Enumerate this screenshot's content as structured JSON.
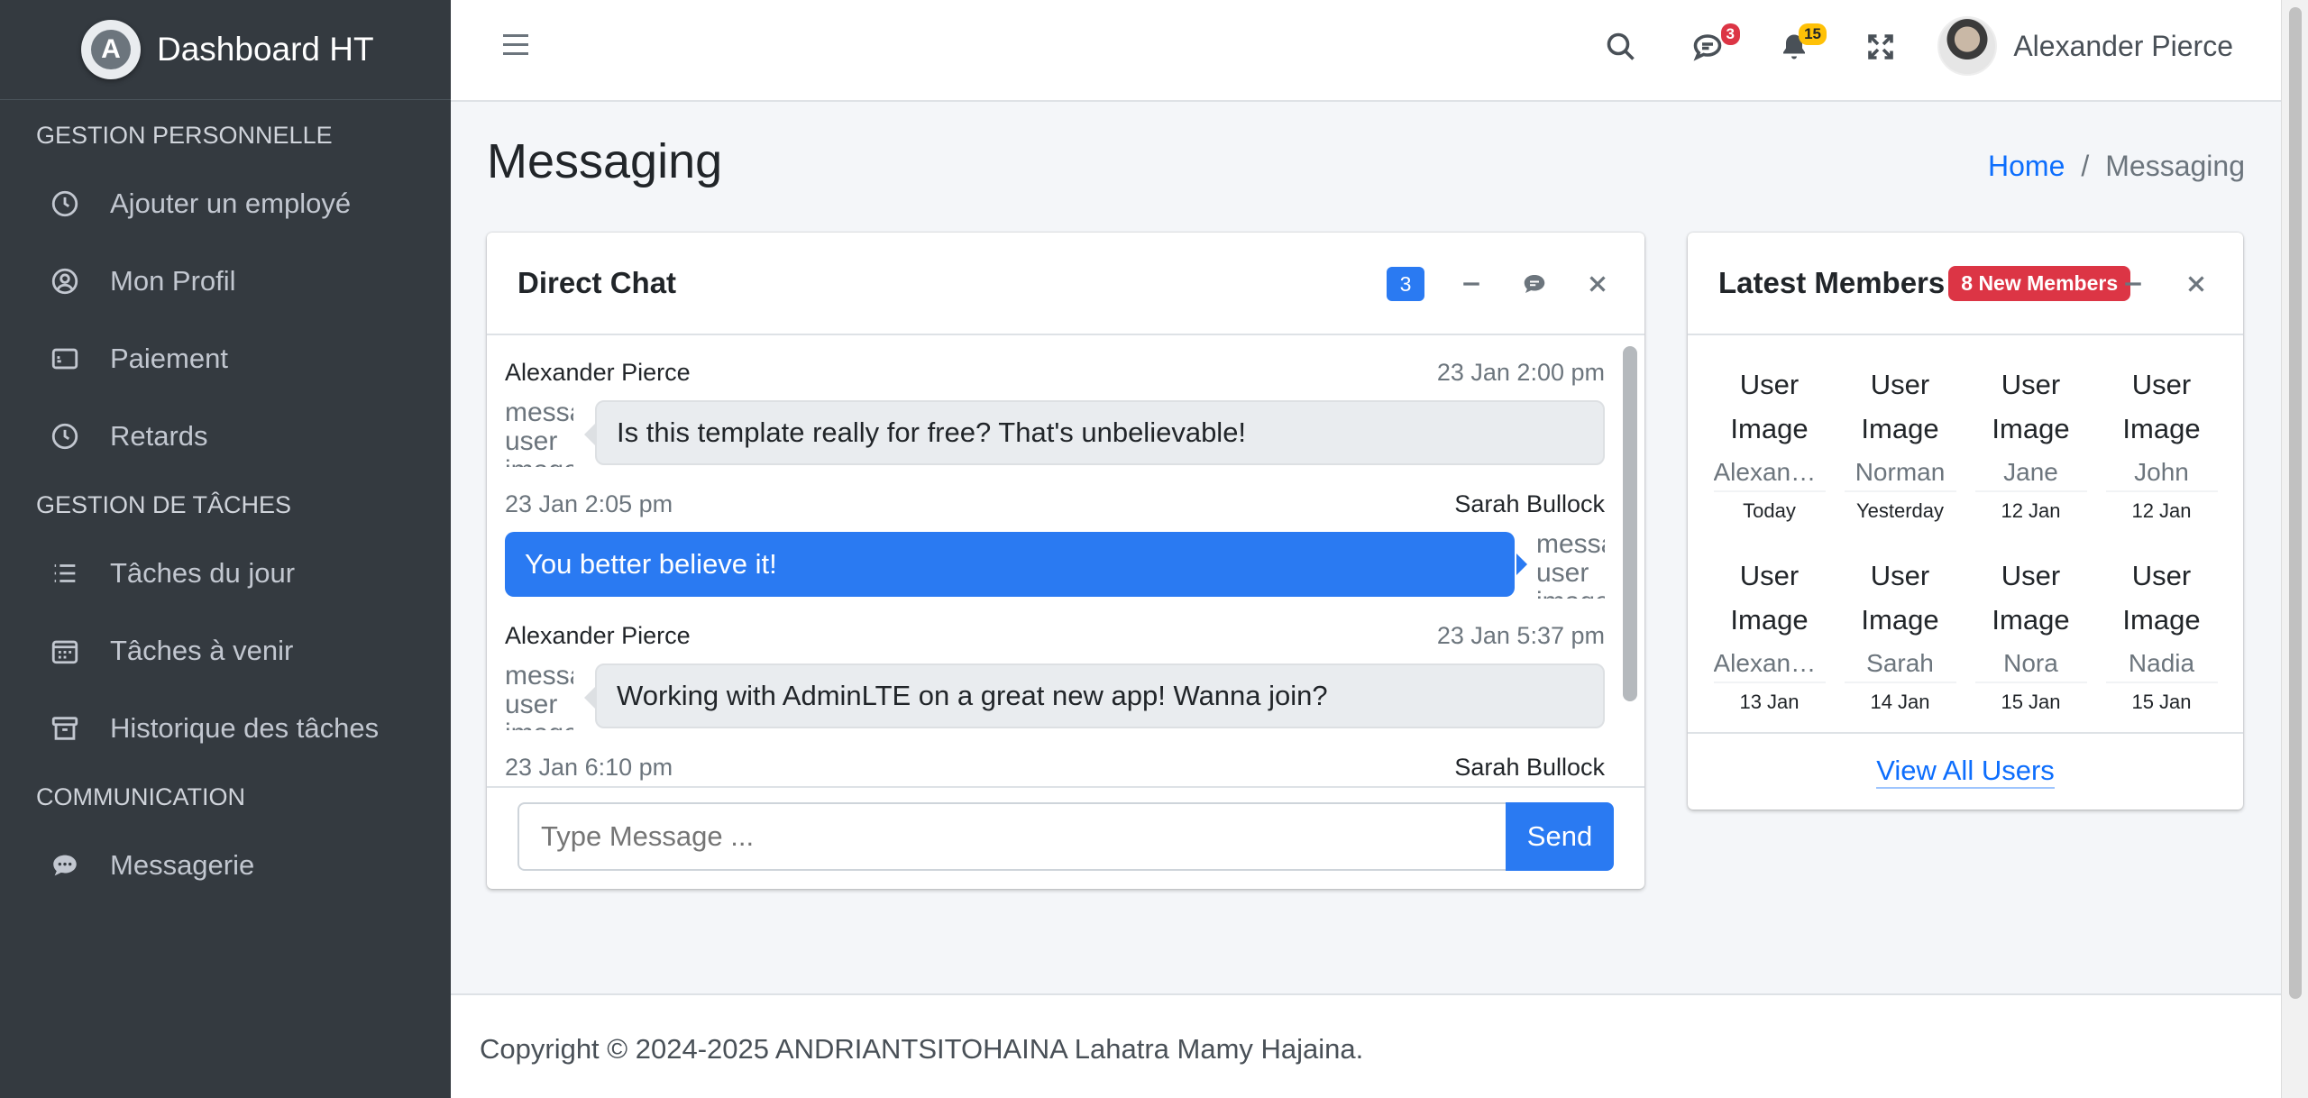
{
  "brand": {
    "name": "Dashboard HT",
    "logo_letter": "A"
  },
  "sidebar": {
    "sections": [
      {
        "header": "GESTION PERSONNELLE",
        "items": [
          {
            "label": "Ajouter un employé",
            "icon": "clock-icon"
          },
          {
            "label": "Mon Profil",
            "icon": "user-circle-icon"
          },
          {
            "label": "Paiement",
            "icon": "card-icon"
          },
          {
            "label": "Retards",
            "icon": "clock-icon"
          }
        ]
      },
      {
        "header": "GESTION DE TÂCHES",
        "items": [
          {
            "label": "Tâches du jour",
            "icon": "list-icon"
          },
          {
            "label": "Tâches à venir",
            "icon": "calendar-icon"
          },
          {
            "label": "Historique des tâches",
            "icon": "archive-icon"
          }
        ]
      },
      {
        "header": "COMMUNICATION",
        "items": [
          {
            "label": "Messagerie",
            "icon": "chat-icon"
          }
        ]
      }
    ]
  },
  "topbar": {
    "messages_count": "3",
    "notifications_count": "15",
    "user_name": "Alexander Pierce"
  },
  "page": {
    "title": "Messaging",
    "breadcrumb": {
      "home": "Home",
      "separator": "/",
      "current": "Messaging"
    }
  },
  "chat": {
    "title": "Direct Chat",
    "badge": "3",
    "messages": [
      {
        "name": "Alexander Pierce",
        "time": "23 Jan 2:00 pm",
        "text": "Is this template really for free? That's unbelievable!",
        "side": "left",
        "img_alt": "message user image"
      },
      {
        "name": "Sarah Bullock",
        "time": "23 Jan 2:05 pm",
        "text": "You better believe it!",
        "side": "right",
        "img_alt": "message user image"
      },
      {
        "name": "Alexander Pierce",
        "time": "23 Jan 5:37 pm",
        "text": "Working with AdminLTE on a great new app! Wanna join?",
        "side": "left",
        "img_alt": "message user image"
      },
      {
        "name": "Sarah Bullock",
        "time": "23 Jan 6:10 pm",
        "text": "",
        "side": "right",
        "img_alt": "message user image"
      }
    ],
    "input_placeholder": "Type Message ...",
    "send_label": "Send"
  },
  "members": {
    "title": "Latest Members",
    "badge": "8 New Members",
    "img_alt": "User Image",
    "list": [
      {
        "name": "Alexander Pierce",
        "date": "Today"
      },
      {
        "name": "Norman",
        "date": "Yesterday"
      },
      {
        "name": "Jane",
        "date": "12 Jan"
      },
      {
        "name": "John",
        "date": "12 Jan"
      },
      {
        "name": "Alexander",
        "date": "13 Jan"
      },
      {
        "name": "Sarah",
        "date": "14 Jan"
      },
      {
        "name": "Nora",
        "date": "15 Jan"
      },
      {
        "name": "Nadia",
        "date": "15 Jan"
      }
    ],
    "view_all": "View All Users"
  },
  "footer": {
    "text": "Copyright © 2024-2025  ANDRIANTSITOHAINA Lahatra Mamy Hajaina."
  },
  "colors": {
    "primary": "#2a7af2",
    "danger": "#dc3545",
    "warning": "#ffc107",
    "sidebar_bg": "#343a40"
  }
}
